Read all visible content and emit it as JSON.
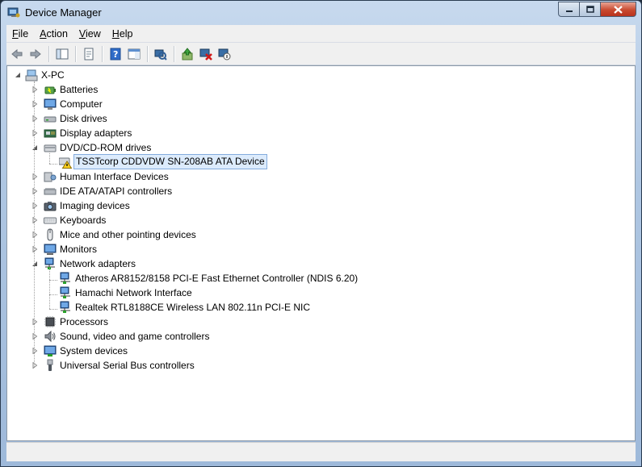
{
  "window": {
    "title": "Device Manager"
  },
  "menu": [
    {
      "label": "File",
      "mnemonic": "F"
    },
    {
      "label": "Action",
      "mnemonic": "A"
    },
    {
      "label": "View",
      "mnemonic": "V"
    },
    {
      "label": "Help",
      "mnemonic": "H"
    }
  ],
  "toolbar": [
    "back-icon",
    "forward-icon",
    "|",
    "show-hide-console-tree-icon",
    "|",
    "properties-icon",
    "|",
    "help-icon",
    "action-pane-icon",
    "|",
    "scan-hardware-icon",
    "|",
    "update-driver-icon",
    "uninstall-icon",
    "disable-device-icon"
  ],
  "tree": {
    "root": "X-PC",
    "categories": [
      {
        "label": "Batteries",
        "icon": "battery-icon"
      },
      {
        "label": "Computer",
        "icon": "computer-icon"
      },
      {
        "label": "Disk drives",
        "icon": "disk-drive-icon"
      },
      {
        "label": "Display adapters",
        "icon": "display-adapter-icon"
      },
      {
        "label": "DVD/CD-ROM drives",
        "icon": "dvd-drive-icon",
        "expanded": true,
        "children": [
          {
            "label": "TSSTcorp CDDVDW SN-208AB ATA Device",
            "icon": "dvd-device-warning-icon",
            "selected": true
          }
        ]
      },
      {
        "label": "Human Interface Devices",
        "icon": "hid-icon"
      },
      {
        "label": "IDE ATA/ATAPI controllers",
        "icon": "ide-controller-icon"
      },
      {
        "label": "Imaging devices",
        "icon": "camera-icon"
      },
      {
        "label": "Keyboards",
        "icon": "keyboard-icon"
      },
      {
        "label": "Mice and other pointing devices",
        "icon": "mouse-icon"
      },
      {
        "label": "Monitors",
        "icon": "monitor-icon"
      },
      {
        "label": "Network adapters",
        "icon": "network-adapter-icon",
        "expanded": true,
        "children": [
          {
            "label": "Atheros AR8152/8158 PCI-E Fast Ethernet Controller (NDIS 6.20)",
            "icon": "network-device-icon"
          },
          {
            "label": "Hamachi Network Interface",
            "icon": "network-device-icon"
          },
          {
            "label": "Realtek RTL8188CE Wireless LAN 802.11n PCI-E NIC",
            "icon": "network-device-icon"
          }
        ]
      },
      {
        "label": "Processors",
        "icon": "processor-icon"
      },
      {
        "label": "Sound, video and game controllers",
        "icon": "sound-icon"
      },
      {
        "label": "System devices",
        "icon": "system-devices-icon"
      },
      {
        "label": "Universal Serial Bus controllers",
        "icon": "usb-icon"
      }
    ]
  },
  "colors": {
    "selection_bg": "#dcebfc",
    "selection_border": "#84acdd",
    "close_button": "#c94a30"
  }
}
